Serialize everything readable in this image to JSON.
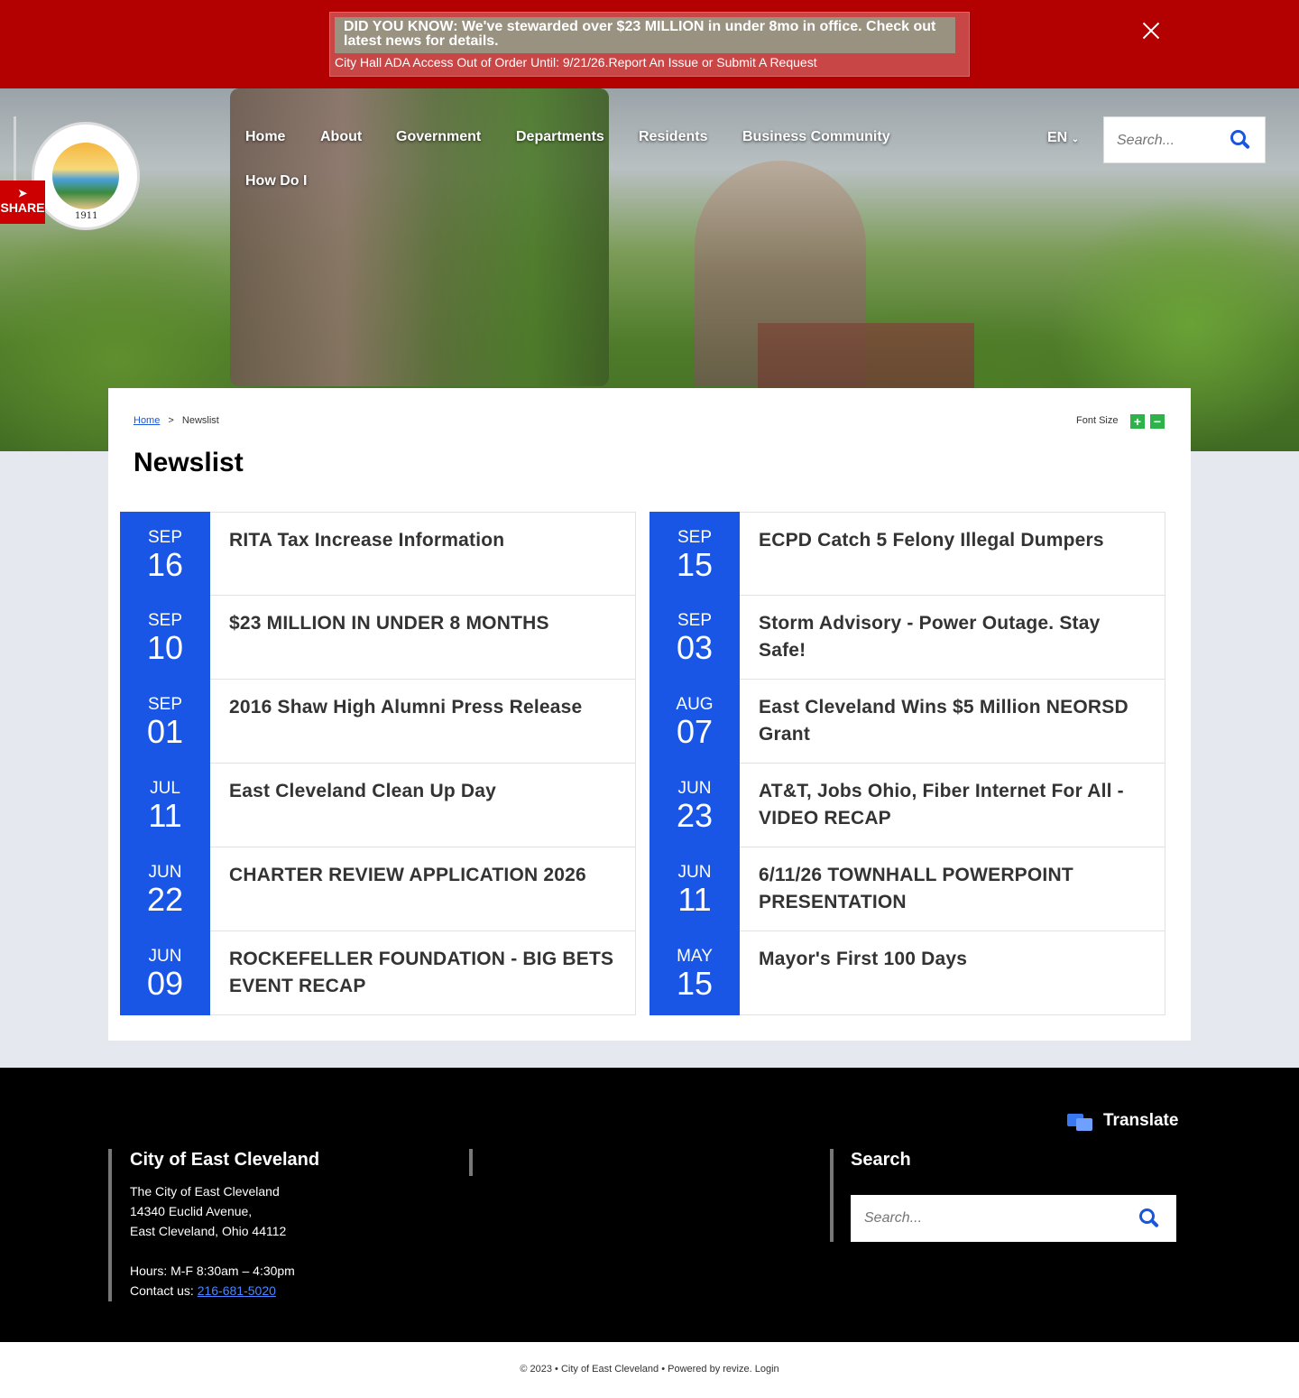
{
  "alert": {
    "headline": "DID YOU KNOW: We've stewarded over $23 MILLION in under 8mo in office. Check out latest news for details.",
    "sub": "City Hall ADA Access Out of Order Until: 9/21/26.Report An Issue or Submit A Request"
  },
  "share_label": "SHARE",
  "logo": {
    "year": "1911"
  },
  "nav": {
    "items": [
      "Home",
      "About",
      "Government",
      "Departments",
      "Residents",
      "Business Community",
      "How Do I"
    ],
    "lang": "EN"
  },
  "header_search": {
    "placeholder": "Search..."
  },
  "breadcrumb": {
    "home": "Home",
    "separator": ">",
    "current": "Newslist"
  },
  "font_size": {
    "label": "Font Size",
    "plus": "+",
    "minus": "−"
  },
  "page_title": "Newslist",
  "news_left": [
    {
      "month": "SEP",
      "day": "16",
      "title": "RITA Tax Increase Information"
    },
    {
      "month": "SEP",
      "day": "10",
      "title": "$23 MILLION IN UNDER 8 MONTHS"
    },
    {
      "month": "SEP",
      "day": "01",
      "title": "2016 Shaw High Alumni Press Release"
    },
    {
      "month": "JUL",
      "day": "11",
      "title": "East Cleveland Clean Up Day"
    },
    {
      "month": "JUN",
      "day": "22",
      "title": "CHARTER REVIEW APPLICATION 2026"
    },
    {
      "month": "JUN",
      "day": "09",
      "title": "ROCKEFELLER FOUNDATION - BIG BETS EVENT RECAP"
    }
  ],
  "news_right": [
    {
      "month": "SEP",
      "day": "15",
      "title": "ECPD Catch 5 Felony Illegal Dumpers"
    },
    {
      "month": "SEP",
      "day": "03",
      "title": "Storm Advisory - Power Outage. Stay Safe!"
    },
    {
      "month": "AUG",
      "day": "07",
      "title": "East Cleveland Wins $5 Million NEORSD Grant"
    },
    {
      "month": "JUN",
      "day": "23",
      "title": "AT&T, Jobs Ohio, Fiber Internet For All - VIDEO RECAP"
    },
    {
      "month": "JUN",
      "day": "11",
      "title": "6/11/26 TOWNHALL POWERPOINT PRESENTATION"
    },
    {
      "month": "MAY",
      "day": "15",
      "title": "Mayor's First 100 Days"
    }
  ],
  "footer": {
    "translate": "Translate",
    "city_heading": "City of East Cleveland",
    "address1": "The City of East Cleveland",
    "address2": "14340 Euclid Avenue,",
    "address3": "East Cleveland, Ohio 44112",
    "hours": "Hours: M-F 8:30am – 4:30pm",
    "contact_label": "Contact us: ",
    "phone": "216-681-5020",
    "search_heading": "Search",
    "search_placeholder": "Search..."
  },
  "copyright": "© 2023 • City of East Cleveland • Powered by revize. Login",
  "colors": {
    "alert_red": "#b30000",
    "date_blue": "#1a56e6",
    "fontsize_green": "#2db34a"
  }
}
